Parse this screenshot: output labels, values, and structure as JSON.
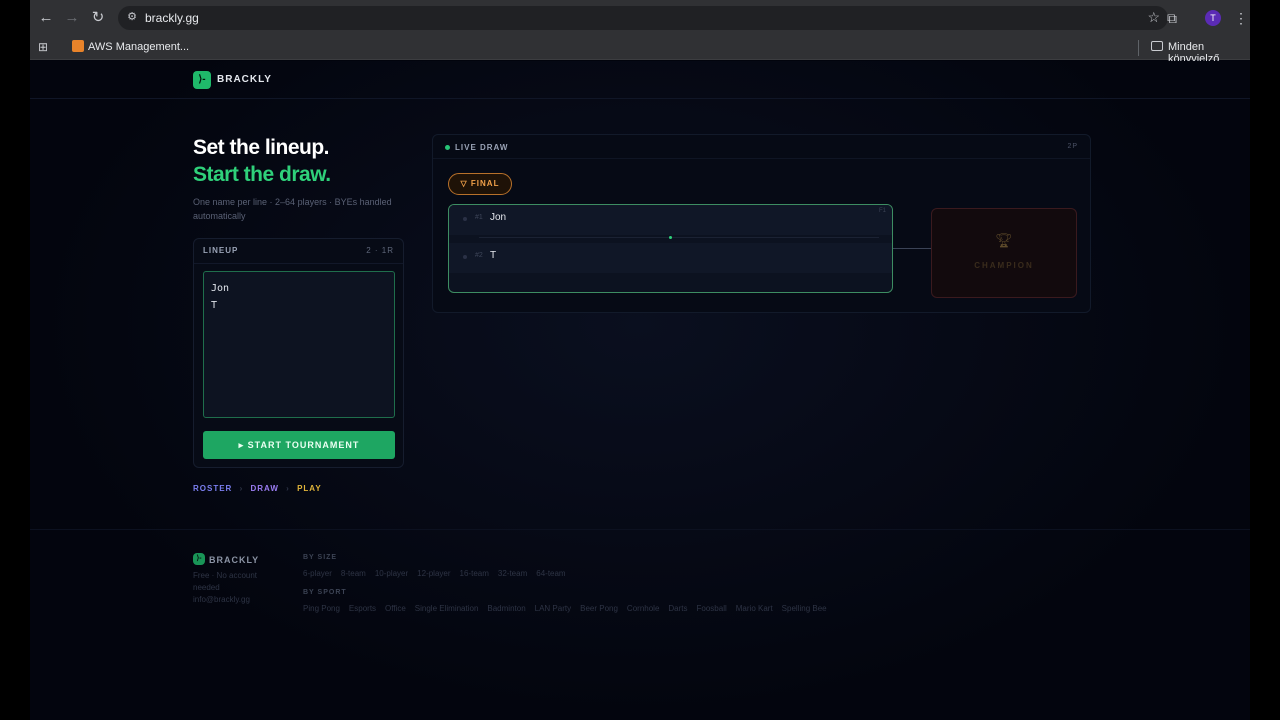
{
  "browser": {
    "url": "brackly.gg",
    "bookmark_aws": "AWS Management...",
    "bookmark_all": "Minden könyvjelző",
    "profile_initial": "T"
  },
  "site": {
    "brand": "BRACKLY",
    "logo_glyph": "⟩-"
  },
  "hero": {
    "line1": "Set the lineup.",
    "line2": "Start the draw.",
    "subtitle": "One name per line · 2–64 players · BYEs handled automatically"
  },
  "lineup": {
    "label": "LINEUP",
    "count": "2 · 1R",
    "names_value": "Jon\nT",
    "start_label": "▸  START TOURNAMENT"
  },
  "steps": [
    {
      "label": "ROSTER",
      "color": "#7b7ff0"
    },
    {
      "label": "DRAW",
      "color": "#9a7cf2"
    },
    {
      "label": "PLAY",
      "color": "#e0b43a"
    }
  ],
  "steps_sep": "›",
  "draw": {
    "label": "LIVE DRAW",
    "count": "2P",
    "round_label": "FINAL",
    "round_icon": "▽",
    "match_id": "F1",
    "players": [
      {
        "seed": "#1",
        "name": "Jon"
      },
      {
        "seed": "#2",
        "name": "T"
      }
    ],
    "champion_label": "CHAMPION",
    "champion_icon": "trophy-icon"
  },
  "footer": {
    "brand": "BRACKLY",
    "tagline": "Free · No account needed",
    "email": "info@brackly.gg",
    "by_size_label": "BY SIZE",
    "by_size": [
      "6-player",
      "8-team",
      "10-player",
      "12-player",
      "16-team",
      "32-team",
      "64-team"
    ],
    "by_sport_label": "BY SPORT",
    "by_sport": [
      "Ping Pong",
      "Esports",
      "Office",
      "Single Elimination",
      "Badminton",
      "LAN Party",
      "Beer Pong",
      "Cornhole",
      "Darts",
      "Foosball",
      "Mario Kart",
      "Spelling Bee"
    ]
  }
}
